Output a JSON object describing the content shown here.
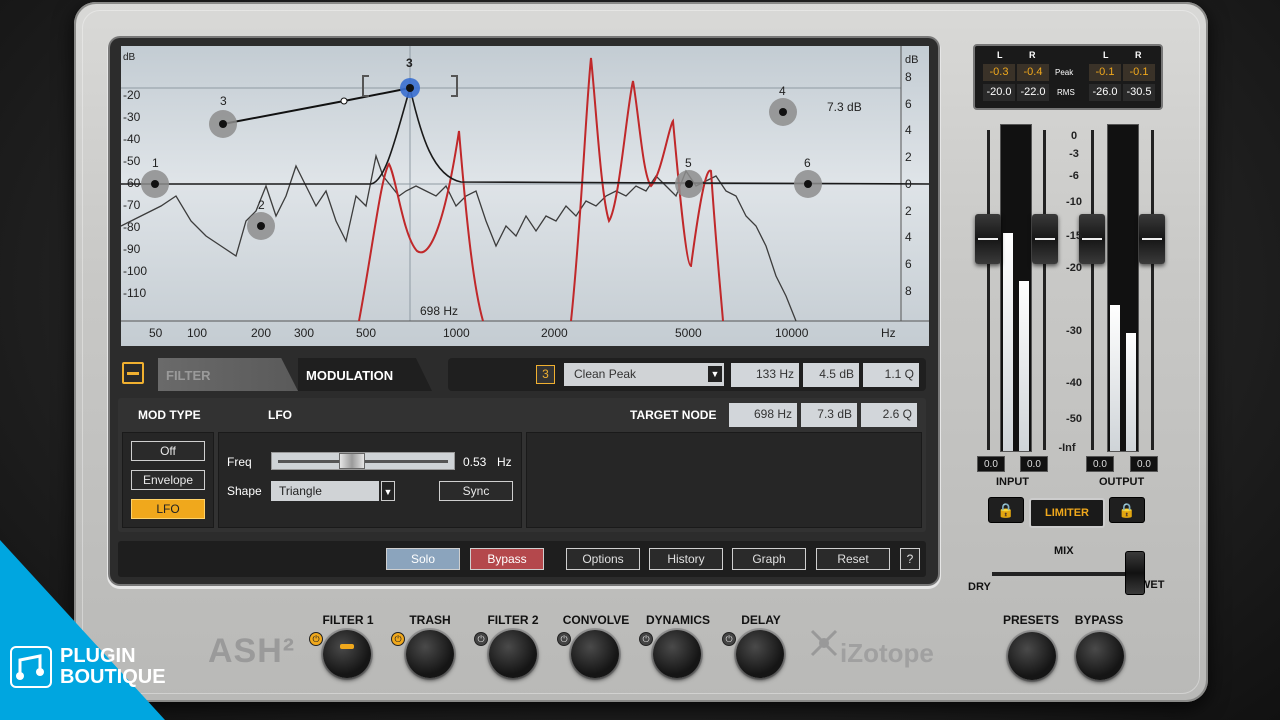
{
  "graph": {
    "db_left_label": "dB",
    "db_left": [
      "-20",
      "-30",
      "-40",
      "-50",
      "-60",
      "-70",
      "-80",
      "-90",
      "-100",
      "-110"
    ],
    "db_right_label": "dB",
    "db_right": [
      "8",
      "6",
      "4",
      "2",
      "0",
      "2",
      "4",
      "6",
      "8"
    ],
    "freq": [
      "50",
      "100",
      "200",
      "300",
      "500",
      "1000",
      "2000",
      "5000",
      "10000",
      "Hz"
    ],
    "cursor_freq": "698 Hz",
    "node_gain_readout": "7.3 dB",
    "nodes": [
      "1",
      "2",
      "3",
      "3",
      "4",
      "5",
      "6"
    ]
  },
  "tabs": {
    "filter": "FILTER",
    "modulation": "MODULATION"
  },
  "node_bar": {
    "node_number": "3",
    "filter_type": "Clean Peak",
    "freq": "133 Hz",
    "gain": "4.5 dB",
    "q": "1.1 Q"
  },
  "mod": {
    "mod_type_label": "MOD TYPE",
    "lfo_label": "LFO",
    "target_node_label": "TARGET NODE",
    "target_freq": "698 Hz",
    "target_gain": "7.3 dB",
    "target_q": "2.6 Q",
    "types": [
      "Off",
      "Envelope",
      "LFO"
    ],
    "freq_label": "Freq",
    "freq_value": "0.53",
    "freq_unit": "Hz",
    "freq_slider_level": 0.43,
    "shape_label": "Shape",
    "shape_value": "Triangle",
    "sync_label": "Sync"
  },
  "bottom": {
    "solo": "Solo",
    "bypass": "Bypass",
    "options": "Options",
    "history": "History",
    "graph": "Graph",
    "reset": "Reset",
    "help": "?"
  },
  "meters": {
    "l": "L",
    "r": "R",
    "peak_label": "Peak",
    "rms_label": "RMS",
    "in_peak_l": "-0.3",
    "in_peak_r": "-0.4",
    "out_peak_l": "-0.1",
    "out_peak_r": "-0.1",
    "in_rms_l": "-20.0",
    "in_rms_r": "-22.0",
    "out_rms_l": "-26.0",
    "out_rms_r": "-30.5",
    "scale": [
      "0",
      "-3",
      "-6",
      "-10",
      "-15",
      "-20",
      "-30",
      "-40",
      "-50",
      "-Inf"
    ],
    "input_l": "0.0",
    "input_r": "0.0",
    "output_l": "0.0",
    "output_r": "0.0",
    "input_label": "INPUT",
    "output_label": "OUTPUT",
    "limiter": "LIMITER",
    "mix_label": "MIX",
    "dry_label": "DRY",
    "wet_label": "WET"
  },
  "modules": [
    {
      "label": "FILTER 1",
      "power": true
    },
    {
      "label": "TRASH",
      "power": true
    },
    {
      "label": "FILTER 2",
      "power": false
    },
    {
      "label": "CONVOLVE",
      "power": false
    },
    {
      "label": "DYNAMICS",
      "power": false
    },
    {
      "label": "DELAY",
      "power": false
    }
  ],
  "right_buttons": {
    "presets": "PRESETS",
    "bypass": "BYPASS"
  },
  "brand": {
    "product_partial": "ASH²",
    "company": "iZotope"
  },
  "watermark": {
    "line1": "PLUGIN",
    "line2": "BOUTIQUE"
  },
  "colors": {
    "accent": "#f0a81c",
    "node_selected": "#3a6fd0",
    "modulation_curve": "#c0282a",
    "watermark_blue": "#00a6e0"
  }
}
